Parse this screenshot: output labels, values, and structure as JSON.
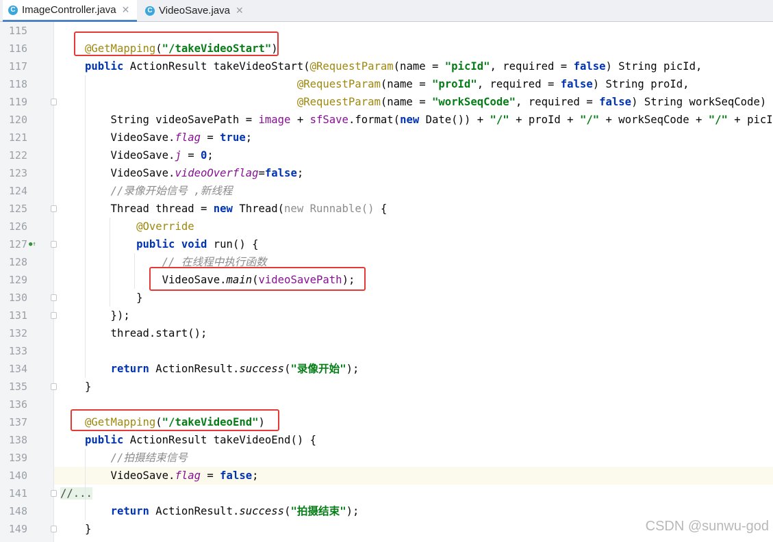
{
  "tabs": [
    {
      "label": "ImageController.java",
      "icon": "C",
      "active": true
    },
    {
      "label": "VideoSave.java",
      "icon": "C",
      "active": false
    }
  ],
  "lines": [
    {
      "n": "115",
      "tokens": []
    },
    {
      "n": "116",
      "indent": 0,
      "tokens": [
        [
          "ann",
          "@GetMapping"
        ],
        [
          "",
          "("
        ],
        [
          "str",
          "\"/takeVideoStart\""
        ],
        [
          "",
          ")"
        ]
      ]
    },
    {
      "n": "117",
      "tokens": [
        [
          "kw",
          "public"
        ],
        [
          "",
          " ActionResult takeVideoStart("
        ],
        [
          "ann",
          "@RequestParam"
        ],
        [
          "",
          "(name = "
        ],
        [
          "str",
          "\"picId\""
        ],
        [
          "",
          ", required = "
        ],
        [
          "kw",
          "false"
        ],
        [
          "",
          ") String picId,"
        ]
      ]
    },
    {
      "n": "118",
      "tokens": [
        [
          "",
          "                                 "
        ],
        [
          "ann",
          "@RequestParam"
        ],
        [
          "",
          "(name = "
        ],
        [
          "str",
          "\"proId\""
        ],
        [
          "",
          ", required = "
        ],
        [
          "kw",
          "false"
        ],
        [
          "",
          ") String proId,"
        ]
      ]
    },
    {
      "n": "119",
      "tokens": [
        [
          "",
          "                                 "
        ],
        [
          "ann",
          "@RequestParam"
        ],
        [
          "",
          "(name = "
        ],
        [
          "str",
          "\"workSeqCode\""
        ],
        [
          "",
          ", required = "
        ],
        [
          "kw",
          "false"
        ],
        [
          "",
          ") String workSeqCode) {"
        ]
      ]
    },
    {
      "n": "120",
      "tokens": [
        [
          "",
          "    String videoSavePath = "
        ],
        [
          "param",
          "image"
        ],
        [
          "",
          " + "
        ],
        [
          "param",
          "sfSave"
        ],
        [
          "",
          ".format("
        ],
        [
          "kw",
          "new"
        ],
        [
          "",
          " Date()) + "
        ],
        [
          "str",
          "\"/\""
        ],
        [
          "",
          " + proId + "
        ],
        [
          "str",
          "\"/\""
        ],
        [
          "",
          " + workSeqCode + "
        ],
        [
          "str",
          "\"/\""
        ],
        [
          "",
          " + picId;"
        ]
      ]
    },
    {
      "n": "121",
      "tokens": [
        [
          "",
          "    VideoSave."
        ],
        [
          "fld",
          "flag"
        ],
        [
          "",
          " = "
        ],
        [
          "kw",
          "true"
        ],
        [
          "",
          ";"
        ]
      ]
    },
    {
      "n": "122",
      "tokens": [
        [
          "",
          "    VideoSave."
        ],
        [
          "fld",
          "j"
        ],
        [
          "",
          " = "
        ],
        [
          "kw",
          "0"
        ],
        [
          "",
          ";"
        ]
      ]
    },
    {
      "n": "123",
      "tokens": [
        [
          "",
          "    VideoSave."
        ],
        [
          "fld",
          "videoOverflag"
        ],
        [
          "",
          "="
        ],
        [
          "kw",
          "false"
        ],
        [
          "",
          ";"
        ]
      ]
    },
    {
      "n": "124",
      "tokens": [
        [
          "",
          "    "
        ],
        [
          "cmt",
          "//录像开始信号 ,新线程"
        ]
      ]
    },
    {
      "n": "125",
      "tokens": [
        [
          "",
          "    Thread thread = "
        ],
        [
          "kw",
          "new"
        ],
        [
          "",
          " Thread("
        ],
        [
          "gray",
          "new Runnable()"
        ],
        [
          "",
          " {"
        ]
      ]
    },
    {
      "n": "126",
      "tokens": [
        [
          "",
          "        "
        ],
        [
          "ann",
          "@Override"
        ]
      ]
    },
    {
      "n": "127",
      "tokens": [
        [
          "",
          "        "
        ],
        [
          "kw",
          "public void"
        ],
        [
          "",
          " run() {"
        ]
      ]
    },
    {
      "n": "128",
      "tokens": [
        [
          "",
          "            "
        ],
        [
          "cmt",
          "// 在线程中执行函数"
        ]
      ]
    },
    {
      "n": "129",
      "tokens": [
        [
          "",
          "            VideoSave."
        ],
        [
          "ital",
          "main"
        ],
        [
          "",
          "("
        ],
        [
          "param",
          "videoSavePath"
        ],
        [
          "",
          ");"
        ]
      ]
    },
    {
      "n": "130",
      "tokens": [
        [
          "",
          "        }"
        ]
      ]
    },
    {
      "n": "131",
      "tokens": [
        [
          "",
          "    });"
        ]
      ]
    },
    {
      "n": "132",
      "tokens": [
        [
          "",
          "    thread.start();"
        ]
      ]
    },
    {
      "n": "133",
      "tokens": []
    },
    {
      "n": "134",
      "tokens": [
        [
          "",
          "    "
        ],
        [
          "kw",
          "return"
        ],
        [
          "",
          " ActionResult."
        ],
        [
          "ital",
          "success"
        ],
        [
          "",
          "("
        ],
        [
          "str",
          "\"录像开始\""
        ],
        [
          "",
          ");"
        ]
      ]
    },
    {
      "n": "135",
      "tokens": [
        [
          "",
          "}"
        ]
      ]
    },
    {
      "n": "136",
      "tokens": []
    },
    {
      "n": "137",
      "tokens": [
        [
          "ann",
          "@GetMapping"
        ],
        [
          "",
          "("
        ],
        [
          "str",
          "\"/takeVideoEnd\""
        ],
        [
          "",
          ")"
        ]
      ]
    },
    {
      "n": "138",
      "tokens": [
        [
          "kw",
          "public"
        ],
        [
          "",
          " ActionResult takeVideoEnd() {"
        ]
      ]
    },
    {
      "n": "139",
      "tokens": [
        [
          "",
          "    "
        ],
        [
          "cmt",
          "//拍摄结束信号"
        ]
      ]
    },
    {
      "n": "140",
      "tokens": [
        [
          "",
          "    VideoSave."
        ],
        [
          "fld",
          "flag"
        ],
        [
          "",
          " = "
        ],
        [
          "kw",
          "false"
        ],
        [
          "",
          ";"
        ]
      ]
    },
    {
      "n": "141",
      "tokens": [
        [
          "fold-dots",
          "//..."
        ]
      ]
    },
    {
      "n": "148",
      "tokens": [
        [
          "",
          "    "
        ],
        [
          "kw",
          "return"
        ],
        [
          "",
          " ActionResult."
        ],
        [
          "ital",
          "success"
        ],
        [
          "",
          "("
        ],
        [
          "str",
          "\"拍摄结束\""
        ],
        [
          "",
          ");"
        ]
      ]
    },
    {
      "n": "149",
      "tokens": [
        [
          "",
          "}"
        ]
      ]
    }
  ],
  "watermark": "CSDN @sunwu-god"
}
